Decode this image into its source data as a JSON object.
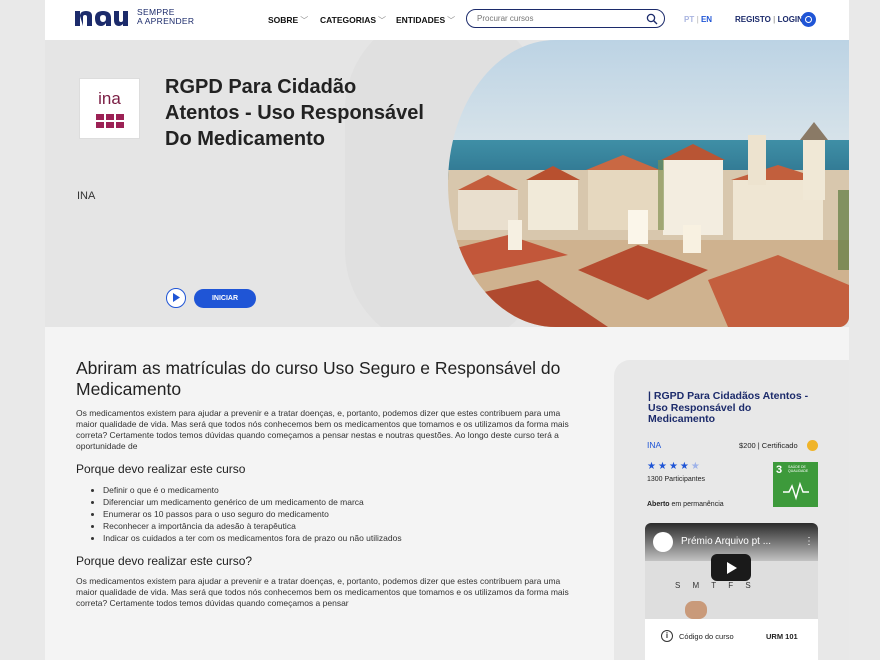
{
  "header": {
    "tagline_line1": "SEMPRE",
    "tagline_line2": "A APRENDER",
    "nav": [
      "SOBRE",
      "CATEGORIAS",
      "ENTIDADES"
    ],
    "search_placeholder": "Procurar cursos",
    "lang_pt": "PT",
    "lang_sep": "|",
    "lang_en": "EN",
    "register": "REGISTO",
    "auth_sep": "|",
    "login": "LOGIN"
  },
  "hero": {
    "org_logo_text": "ina",
    "title": "RGPD Para Cidadão Atentos - Uso Responsável Do Medicamento",
    "org": "INA",
    "start_label": "INICIAR"
  },
  "content": {
    "heading": "Abriram as matrículas do curso Uso Seguro e Responsável do Medicamento",
    "intro": "Os medicamentos existem para ajudar a prevenir e a tratar doenças, e, portanto, podemos dizer que estes contribuem para uma maior qualidade de vida. Mas será que todos nós conhecemos bem os medicamentos que tomamos e os utilizamos da forma mais correta? Certamente todos temos dúvidas quando começamos a pensar nestas e noutras questões. Ao longo deste curso terá a oportunidade de",
    "section1_title": "Porque devo realizar este curso",
    "bullets": [
      "Definir o que é o medicamento",
      "Diferenciar um medicamento genérico de um medicamento de marca",
      "Enumerar os 10 passos para o uso seguro do medicamento",
      "Reconhecer a importância da adesão à terapêutica",
      "Indicar os cuidados a ter com os medicamentos fora de prazo ou não utilizados"
    ],
    "section2_title": "Porque devo realizar este curso?",
    "outro": "Os medicamentos existem para ajudar a prevenir e a tratar doenças, e, portanto, podemos dizer que estes contribuem para uma maior qualidade de vida. Mas será que todos nós conhecemos bem os medicamentos que tomamos e os utilizamos da forma mais correta? Certamente todos temos dúvidas quando começamos a pensar"
  },
  "sidebar": {
    "title": "| RGPD Para Cidadãos Atentos - Uso Responsável do Medicamento",
    "org": "INA",
    "price": "$200 | Certificado",
    "rating": 4,
    "rating_max": 5,
    "participants": "1300 Participantes",
    "sdg_number": "3",
    "sdg_label": "SAÚDE DE QUALIDADE",
    "status_bold": "Aberto",
    "status_rest": " em permanência",
    "video_title": "Prémio Arquivo pt ...",
    "video_board": "S M T F S",
    "code_label": "Código do curso",
    "code_value": "URM 101"
  },
  "colors": {
    "primary": "#1f55d6",
    "navy": "#1c2b6b",
    "ina_magenta": "#9c2155",
    "sdg_green": "#3d9a3b"
  }
}
